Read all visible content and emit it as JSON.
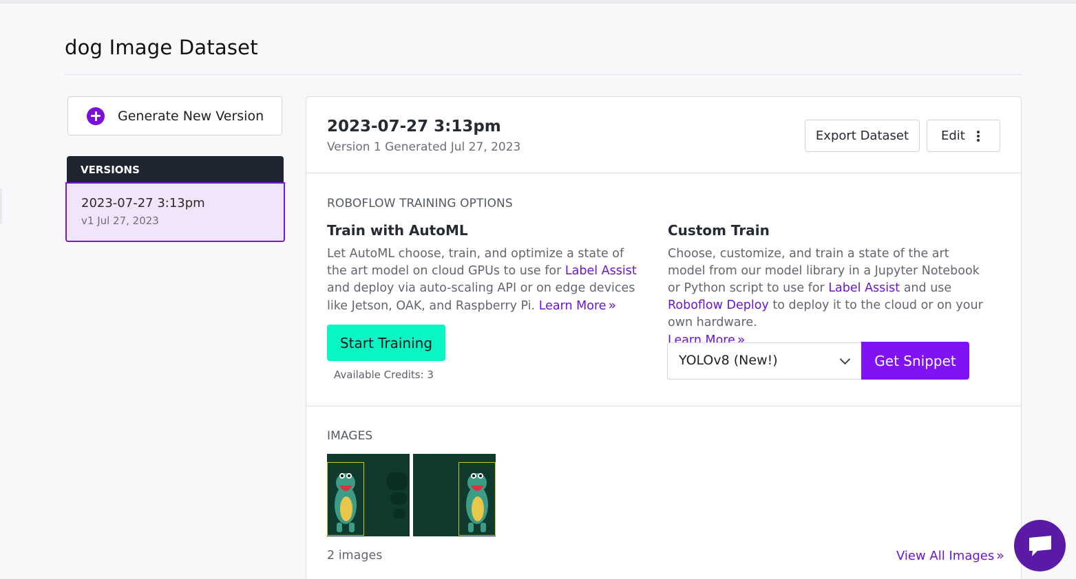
{
  "page": {
    "title": "dog Image Dataset"
  },
  "sidebar": {
    "generate_button_label": "Generate New Version",
    "versions_header": "VERSIONS",
    "versions": [
      {
        "title": "2023-07-27 3:13pm",
        "subtitle": "v1 Jul 27, 2023",
        "selected": true
      }
    ]
  },
  "version_panel": {
    "title": "2023-07-27 3:13pm",
    "subtitle": "Version 1 Generated Jul 27, 2023",
    "export_label": "Export Dataset",
    "edit_label": "Edit",
    "training_section_label": "ROBOFLOW TRAINING OPTIONS",
    "automl": {
      "title": "Train with AutoML",
      "text_1": "Let AutoML choose, train, and optimize a state of the art model on cloud GPUs to use for ",
      "link_label_assist": "Label Assist",
      "text_2": " and deploy via auto-scaling API or on edge devices like Jetson, OAK, and Raspberry Pi. ",
      "learn_more": "Learn More",
      "start_button": "Start Training",
      "credits": "Available Credits: 3"
    },
    "custom": {
      "title": "Custom Train",
      "text_1": "Choose, customize, and train a state of the art model from our model library in a Jupyter Notebook or Python script to use for ",
      "link_label_assist": "Label Assist",
      "text_2": " and use ",
      "link_deploy": "Roboflow Deploy",
      "text_3": " to deploy it to the cloud or on your own hardware.",
      "learn_more": "Learn More",
      "model_select_value": "YOLOv8 (New!)",
      "snippet_button": "Get Snippet"
    },
    "images": {
      "section_label": "IMAGES",
      "count_text": "2 images",
      "view_all": "View All Images",
      "thumbnails": [
        {
          "box_side": "left"
        },
        {
          "box_side": "right"
        }
      ]
    }
  },
  "colors": {
    "accent_purple": "#7b0ed8",
    "start_training_bg": "#08f5c4",
    "snippet_bg": "#8012f4",
    "selected_version_bg": "#f2e4fb",
    "versions_header_bg": "#1e2531"
  },
  "icons": {
    "generate": "plus-circle-icon",
    "edit_menu": "kebab-menu-icon",
    "select_caret": "chevron-down-icon",
    "learn_more": "double-chevron-right-icon",
    "chat": "chat-bubble-icon"
  }
}
